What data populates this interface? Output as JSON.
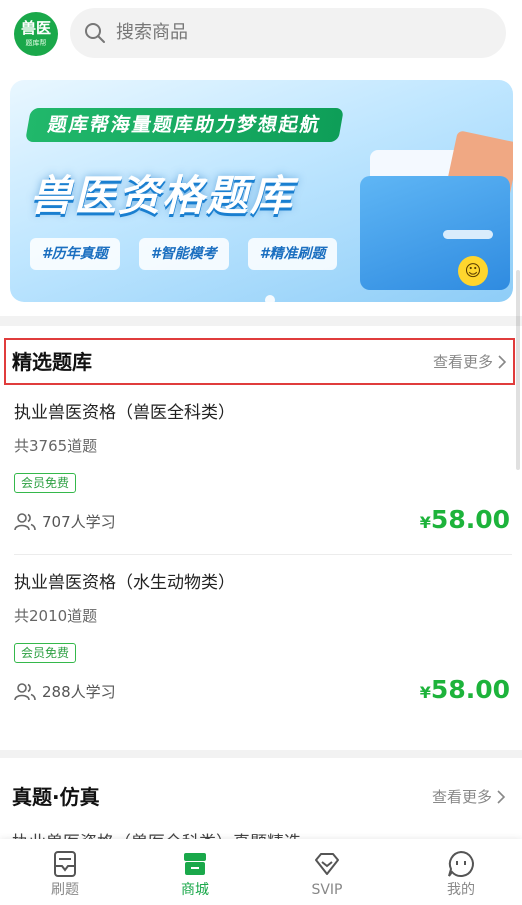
{
  "header": {
    "logo_main": "兽医",
    "logo_sub": "题库帮",
    "search_placeholder": "搜索商品"
  },
  "banner": {
    "tag": "题库帮海量题库助力梦想起航",
    "title": "兽医资格题库",
    "chips": [
      "#历年真题",
      "#智能模考",
      "#精准刷题"
    ]
  },
  "featured": {
    "title": "精选题库",
    "more": "查看更多",
    "items": [
      {
        "title": "执业兽医资格（兽医全科类）",
        "count": "共3765道题",
        "badge": "会员免费",
        "learners": "707人学习",
        "currency": "¥",
        "price": "58.00"
      },
      {
        "title": "执业兽医资格（水生动物类）",
        "count": "共2010道题",
        "badge": "会员免费",
        "learners": "288人学习",
        "currency": "¥",
        "price": "58.00"
      }
    ]
  },
  "exams": {
    "title": "真题·仿真",
    "more": "查看更多",
    "peek": "执业兽医资格（兽医全科类）真题精选"
  },
  "tabs": [
    {
      "label": "刷题",
      "icon": "practice-icon",
      "active": false
    },
    {
      "label": "商城",
      "icon": "store-icon",
      "active": true
    },
    {
      "label": "SVIP",
      "icon": "diamond-icon",
      "active": false
    },
    {
      "label": "我的",
      "icon": "profile-chat-icon",
      "active": false
    }
  ],
  "colors": {
    "accent": "#1aa84a",
    "price": "#1db33b",
    "highlight_border": "#e03c3c"
  }
}
